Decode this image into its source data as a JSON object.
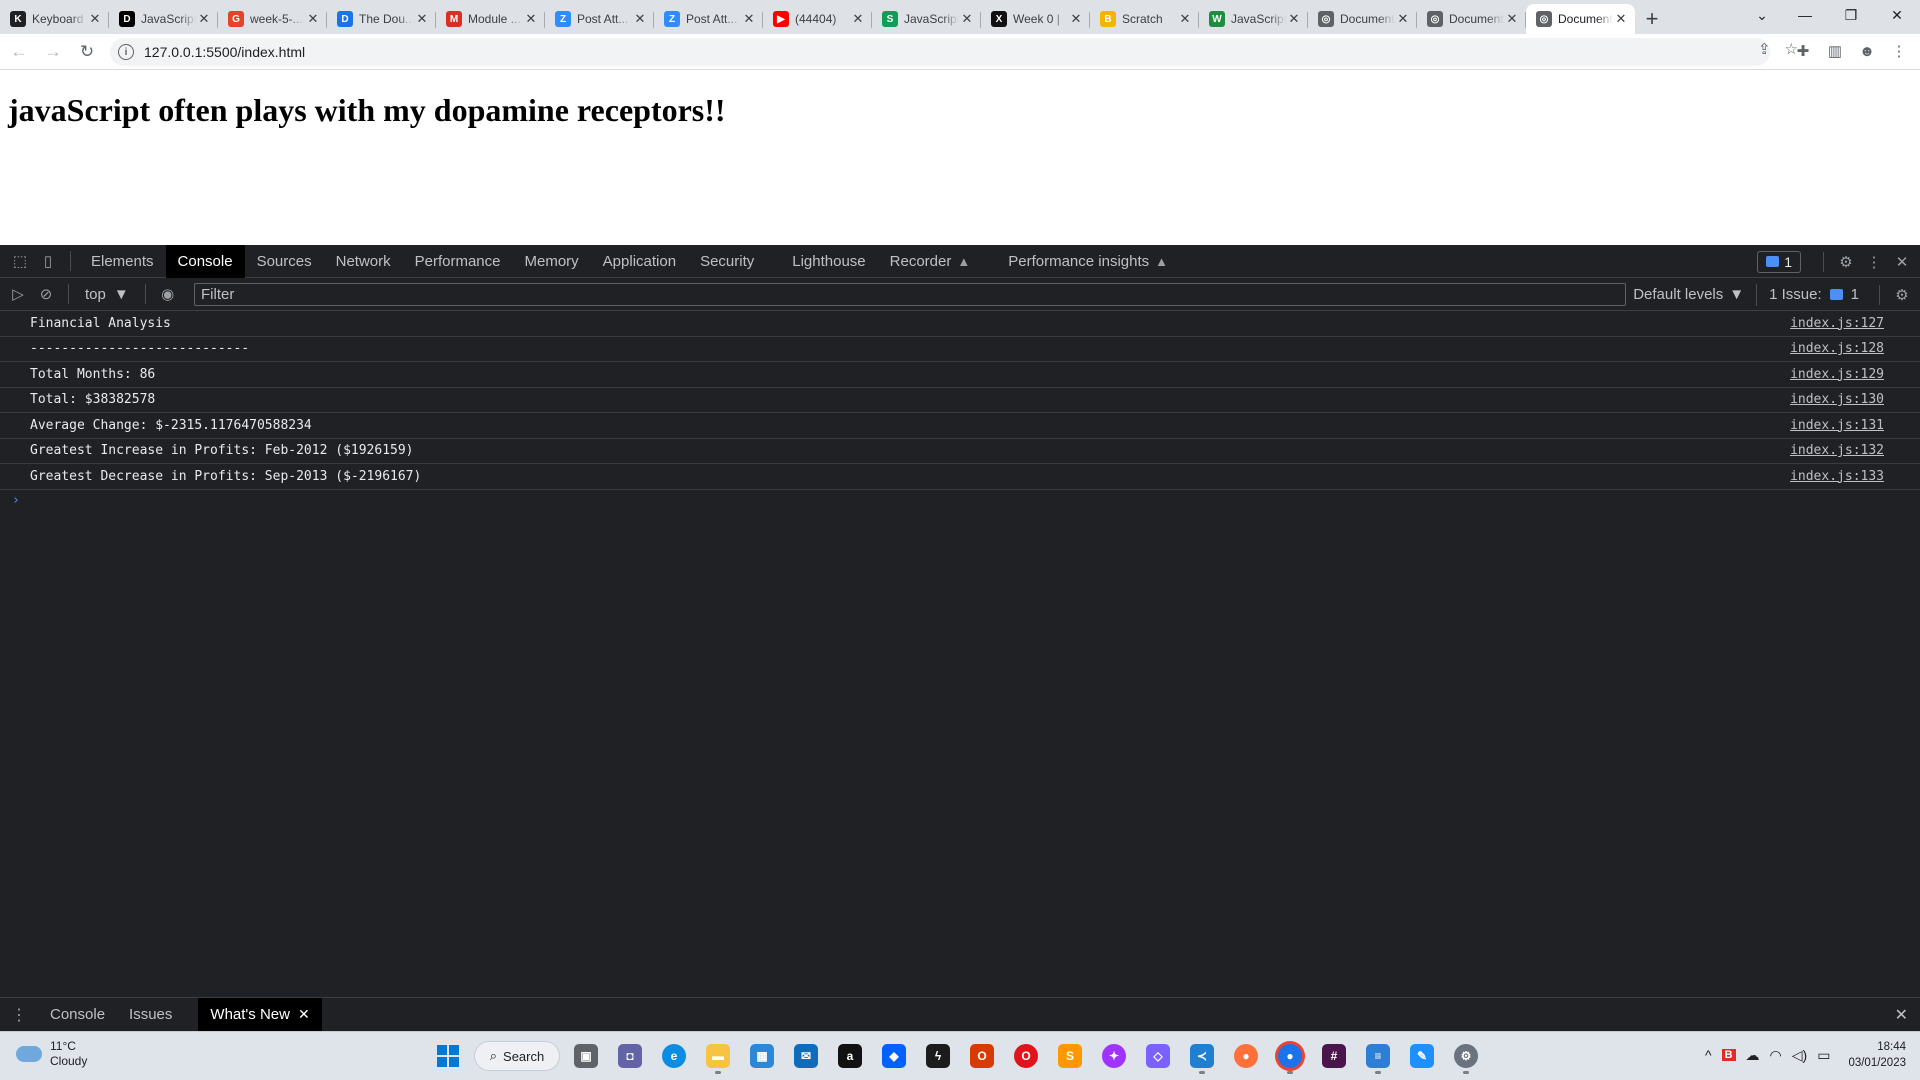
{
  "browser": {
    "tabs": [
      {
        "title": "Keyboard",
        "fav": "K",
        "color": "#202124"
      },
      {
        "title": "JavaScript",
        "fav": "D",
        "color": "#000000"
      },
      {
        "title": "week-5-...",
        "fav": "G",
        "color": "#e24329"
      },
      {
        "title": "The Dou...",
        "fav": "D",
        "color": "#1a73e8"
      },
      {
        "title": "Module ...",
        "fav": "M",
        "color": "#d93025"
      },
      {
        "title": "Post Att...",
        "fav": "Z",
        "color": "#2d8cff"
      },
      {
        "title": "Post Att...",
        "fav": "Z",
        "color": "#2d8cff"
      },
      {
        "title": "(44404)",
        "fav": "▶",
        "color": "#ff0000"
      },
      {
        "title": "JavaScript",
        "fav": "S",
        "color": "#0f9d58"
      },
      {
        "title": "Week 0 |",
        "fav": "X",
        "color": "#111111"
      },
      {
        "title": "Scratch",
        "fav": "B",
        "color": "#f4b400"
      },
      {
        "title": "JavaScript",
        "fav": "W",
        "color": "#1e8e3e"
      },
      {
        "title": "Document",
        "fav": "◎",
        "color": "#5f6368"
      },
      {
        "title": "Document",
        "fav": "◎",
        "color": "#5f6368"
      },
      {
        "title": "Document",
        "fav": "◎",
        "color": "#5f6368",
        "active": true
      }
    ],
    "url": "127.0.0.1:5500/index.html"
  },
  "page": {
    "heading": "javaScript often plays with my dopamine receptors!!"
  },
  "devtools": {
    "tabs": [
      "Elements",
      "Console",
      "Sources",
      "Network",
      "Performance",
      "Memory",
      "Application",
      "Security",
      "Lighthouse",
      "Recorder",
      "Performance insights"
    ],
    "active_tab": "Console",
    "issue_badge": "1",
    "context": "top",
    "filter_placeholder": "Filter",
    "levels": "Default levels",
    "issues_label": "1 Issue:",
    "issues_count": "1",
    "console_lines": [
      {
        "text": "Financial Analysis",
        "source": "index.js:127"
      },
      {
        "text": "----------------------------",
        "source": "index.js:128"
      },
      {
        "text": "Total Months: 86",
        "source": "index.js:129"
      },
      {
        "text": "Total: $38382578",
        "source": "index.js:130"
      },
      {
        "text": "Average Change: $-2315.1176470588234",
        "source": "index.js:131"
      },
      {
        "text": "Greatest Increase in Profits: Feb-2012 ($1926159)",
        "source": "index.js:132"
      },
      {
        "text": "Greatest Decrease in Profits: Sep-2013 ($-2196167)",
        "source": "index.js:133"
      }
    ],
    "prompt": "›",
    "drawer_tabs": [
      "Console",
      "Issues",
      "What's New"
    ],
    "drawer_active": "What's New"
  },
  "taskbar": {
    "temperature": "11°C",
    "condition": "Cloudy",
    "search_label": "Search",
    "time": "18:44",
    "date": "03/01/2023"
  }
}
